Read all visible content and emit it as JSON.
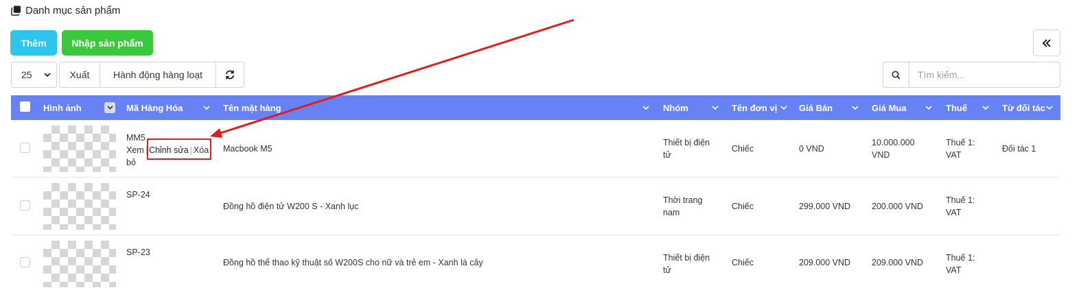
{
  "page": {
    "title": "Danh mục sản phẩm",
    "title_icon": "copy-icon"
  },
  "actions": {
    "add_label": "Thêm",
    "import_label": "Nhập sản phẩm"
  },
  "toolbar": {
    "page_size": "25",
    "export_label": "Xuất",
    "bulk_label": "Hành động hàng loạt",
    "refresh_icon": "refresh-icon"
  },
  "search": {
    "placeholder": "Tìm kiếm..."
  },
  "colors": {
    "header_bg": "#6682f5",
    "add_button": "#2ec5ec",
    "import_button": "#3cc83c",
    "link": "#1a1ae6",
    "annotation": "#e21b1b"
  },
  "table": {
    "columns": {
      "image": "Hình ảnh",
      "code": "Mã Hàng Hóa",
      "name": "Tên mặt hàng",
      "group": "Nhóm",
      "unit": "Tên đơn vị",
      "sale_price": "Giá Bán",
      "buy_price": "Giá Mua",
      "tax": "Thuế",
      "partner": "Từ đối tác"
    },
    "row_actions": {
      "view": "Xem",
      "edit": "Chỉnh sửa",
      "delete": "Xóa bỏ"
    },
    "rows": [
      {
        "code": "MM5",
        "name": "Macbook M5",
        "group_l1": "Thiết bị điện",
        "group_l2": "tử",
        "unit": "Chiếc",
        "sale_price": "0 VND",
        "buy_l1": "10.000.000",
        "buy_l2": "VND",
        "tax_l1": "Thuế 1:",
        "tax_l2": "VAT",
        "partner": "Đối tác 1"
      },
      {
        "code": "SP-24",
        "name": "Đồng hồ điện tử W200 S - Xanh lục",
        "group_l1": "Thời trang",
        "group_l2": "nam",
        "unit": "Chiếc",
        "sale_price": "299.000 VND",
        "buy_l1": "200.000 VND",
        "buy_l2": "",
        "tax_l1": "Thuế 1:",
        "tax_l2": "VAT",
        "partner": ""
      },
      {
        "code": "SP-23",
        "name": "Đồng hồ thể thao kỹ thuật số W200S cho nữ và trẻ em - Xanh lá cây",
        "group_l1": "Thiết bị điện",
        "group_l2": "tử",
        "unit": "Chiếc",
        "sale_price": "209.000 VND",
        "buy_l1": "209.000 VND",
        "buy_l2": "",
        "tax_l1": "Thuế 1:",
        "tax_l2": "VAT",
        "partner": ""
      }
    ]
  }
}
